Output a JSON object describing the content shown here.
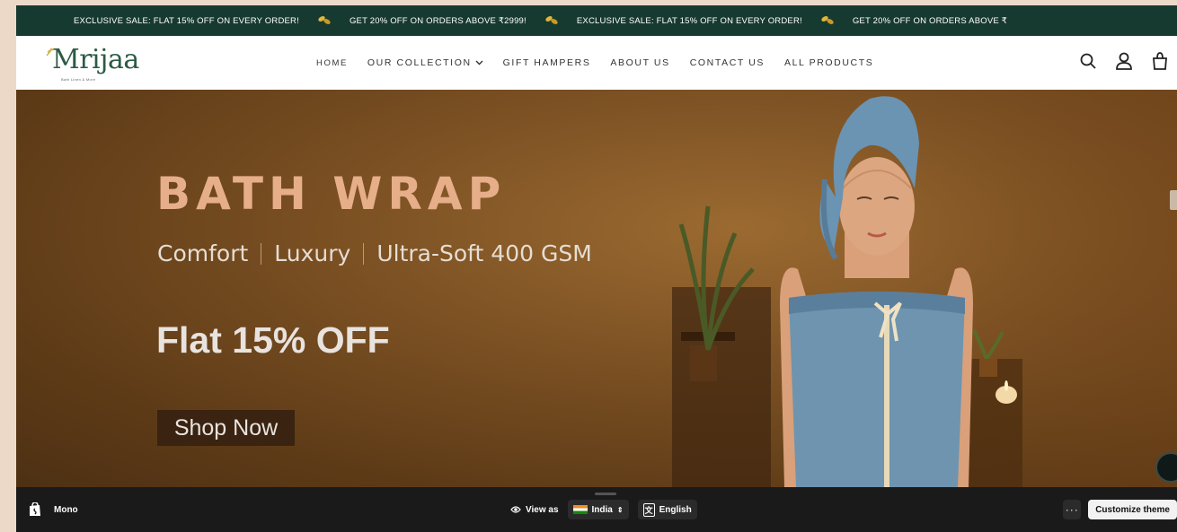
{
  "announcement": {
    "messages": [
      "EXCLUSIVE SALE: FLAT 15% OFF ON EVERY ORDER!",
      "GET 20% OFF ON ORDERS ABOVE ₹2999!",
      "EXCLUSIVE SALE: FLAT 15% OFF ON EVERY ORDER!",
      "GET 20% OFF ON ORDERS ABOVE ₹"
    ],
    "background": "#173a30",
    "icon": "leaf-icon"
  },
  "header": {
    "logo_text": "Mrijaa",
    "logo_tagline": "Bath Linen & More",
    "nav": [
      "HOME",
      "OUR COLLECTION",
      "GIFT HAMPERS",
      "ABOUT US",
      "CONTACT US",
      "ALL PRODUCTS"
    ],
    "icons": [
      "search-icon",
      "account-icon",
      "cart-icon"
    ]
  },
  "hero": {
    "title": "BATH WRAP",
    "subtitle_parts": [
      "Comfort",
      "Luxury",
      "Ultra-Soft 400 GSM"
    ],
    "offer": "Flat 15% OFF",
    "cta": "Shop Now",
    "accent": "#e7ae8a"
  },
  "admin_bar": {
    "store_name": "Mono",
    "view_as_label": "View as",
    "country": "India",
    "language": "English",
    "more": "···",
    "customize_label": "Customize theme"
  }
}
